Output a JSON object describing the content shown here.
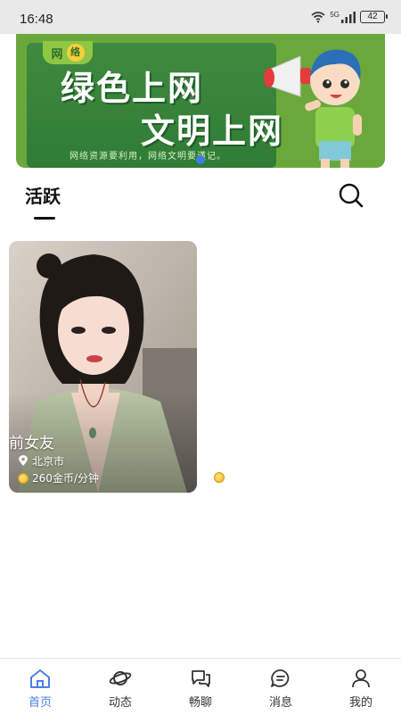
{
  "status_bar": {
    "time": "16:48",
    "network": "5G",
    "battery": "42"
  },
  "banner": {
    "tag_left": "网",
    "tag_right": "络",
    "line1": "绿色上网",
    "line2": "文明上网",
    "subtitle": "网络资源要利用，网络文明要谨记。"
  },
  "tabs": {
    "active": "活跃"
  },
  "cards": [
    {
      "name": "前女友",
      "location": "北京市",
      "price": "260金币/分钟"
    }
  ],
  "bottom_nav": [
    {
      "label": "首页",
      "icon": "home-icon",
      "active": true
    },
    {
      "label": "动态",
      "icon": "planet-icon",
      "active": false
    },
    {
      "label": "畅聊",
      "icon": "chat-bubbles-icon",
      "active": false
    },
    {
      "label": "消息",
      "icon": "message-icon",
      "active": false
    },
    {
      "label": "我的",
      "icon": "profile-icon",
      "active": false
    }
  ],
  "colors": {
    "accent": "#4a7fe6",
    "banner_green": "#2f7c35"
  }
}
